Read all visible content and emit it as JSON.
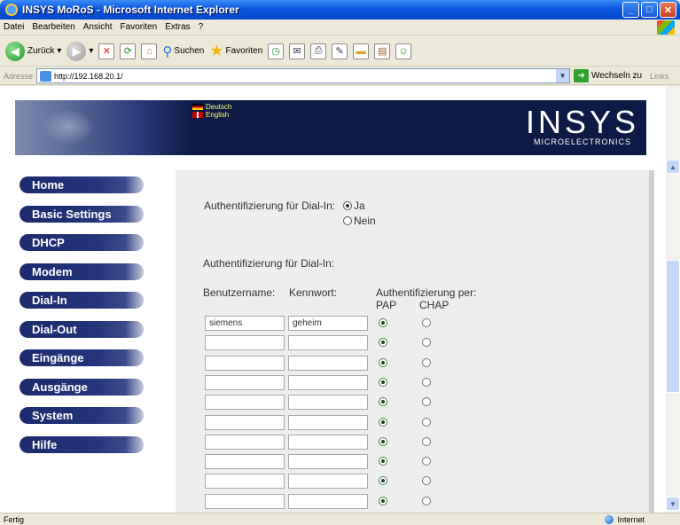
{
  "window": {
    "title": "INSYS MoRoS - Microsoft Internet Explorer"
  },
  "menubar": [
    "Datei",
    "Bearbeiten",
    "Ansicht",
    "Favoriten",
    "Extras",
    "?"
  ],
  "toolbar": {
    "back_label": "Zurück",
    "search_label": "Suchen",
    "favorites_label": "Favoriten"
  },
  "addressbar": {
    "label": "Adresse",
    "url": "http://192.168.20.1/",
    "go_label": "Wechseln zu",
    "links_label": "Links"
  },
  "banner": {
    "lang_de": "Deutsch",
    "lang_en": "English",
    "logo_main": "INSYS",
    "logo_sub": "MICROELECTRONICS"
  },
  "nav": [
    "Home",
    "Basic Settings",
    "DHCP",
    "Modem",
    "Dial-In",
    "Dial-Out",
    "Eingänge",
    "Ausgänge",
    "System",
    "Hilfe"
  ],
  "form": {
    "auth_question": "Authentifizierung für Dial-In:",
    "opt_yes": "Ja",
    "opt_no": "Nein",
    "selected": "Ja",
    "section_title": "Authentifizierung für Dial-In:",
    "col_user": "Benutzername:",
    "col_pass": "Kennwort:",
    "col_auth": "Authentifizierung per:",
    "col_pap": "PAP",
    "col_chap": "CHAP",
    "rows": [
      {
        "user": "siemens",
        "pass": "geheim",
        "method": "PAP"
      },
      {
        "user": "",
        "pass": "",
        "method": "PAP"
      },
      {
        "user": "",
        "pass": "",
        "method": "PAP"
      },
      {
        "user": "",
        "pass": "",
        "method": "PAP"
      },
      {
        "user": "",
        "pass": "",
        "method": "PAP"
      },
      {
        "user": "",
        "pass": "",
        "method": "PAP"
      },
      {
        "user": "",
        "pass": "",
        "method": "PAP"
      },
      {
        "user": "",
        "pass": "",
        "method": "PAP"
      },
      {
        "user": "",
        "pass": "",
        "method": "PAP"
      },
      {
        "user": "",
        "pass": "",
        "method": "PAP"
      }
    ]
  },
  "statusbar": {
    "left": "Fertig",
    "zone": "Internet"
  }
}
